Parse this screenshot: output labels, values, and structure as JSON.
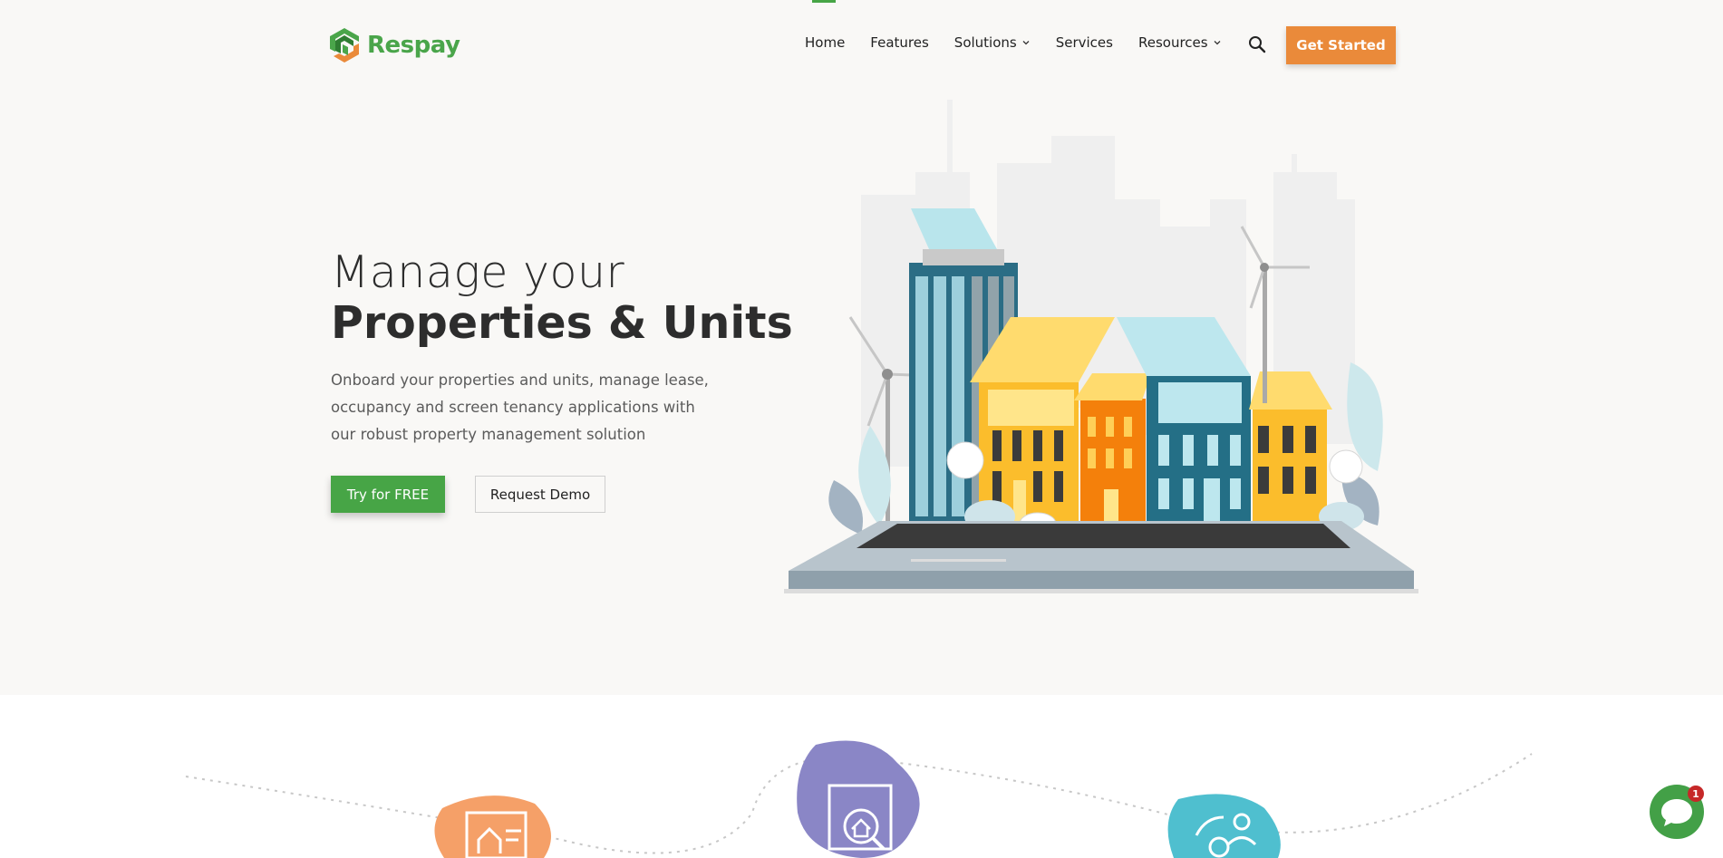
{
  "header": {
    "brand": "Respay",
    "nav": [
      {
        "label": "Home",
        "has_dropdown": false
      },
      {
        "label": "Features",
        "has_dropdown": false
      },
      {
        "label": "Solutions",
        "has_dropdown": true
      },
      {
        "label": "Services",
        "has_dropdown": false
      },
      {
        "label": "Resources",
        "has_dropdown": true
      }
    ],
    "search_icon": "search-icon",
    "cta_label": "Get Started"
  },
  "hero": {
    "headline_line1": "Manage your",
    "headline_line2": "Properties & Units",
    "description": "Onboard your properties and units, manage lease, occupancy and screen tenancy applications with our robust property management solution",
    "primary_button": "Try for FREE",
    "secondary_button": "Request Demo"
  },
  "features": {
    "icons": [
      "property-listing-icon",
      "property-search-icon",
      "tenant-payment-icon"
    ]
  },
  "chat": {
    "badge_count": "1",
    "icon": "chat-bubble-icon"
  },
  "colors": {
    "brand_green": "#47a546",
    "accent_orange": "#ea8a3a",
    "hero_background": "#f9f8f6",
    "feature_purple": "#8a86c6",
    "feature_teal": "#4fbfcf"
  }
}
